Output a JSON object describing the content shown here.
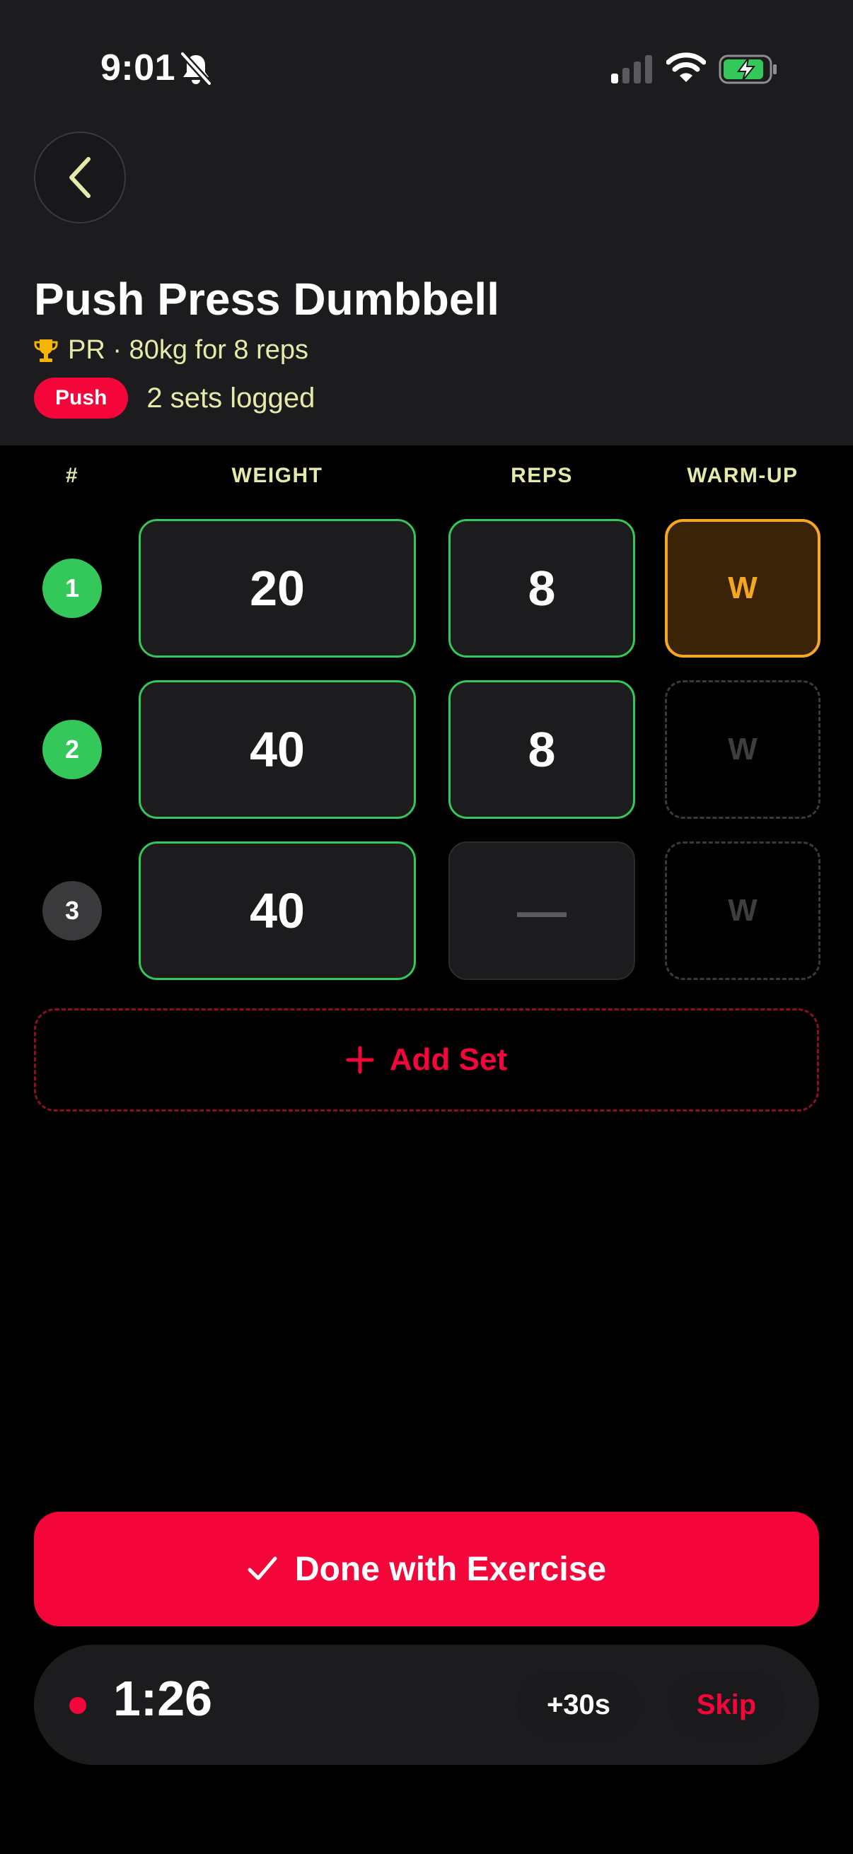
{
  "status_bar": {
    "time": "9:01"
  },
  "exercise": {
    "title": "Push Press Dumbbell",
    "pr_text": "PR · 80kg for 8 reps",
    "tag": "Push",
    "sets_logged": "2 sets logged"
  },
  "table": {
    "headers": {
      "num": "#",
      "weight": "WEIGHT",
      "reps": "REPS",
      "warmup": "WARM-UP"
    },
    "rows": [
      {
        "num": "1",
        "weight": "20",
        "reps": "8",
        "warmup": "W",
        "completed": true,
        "warmup_active": true
      },
      {
        "num": "2",
        "weight": "40",
        "reps": "8",
        "warmup": "W",
        "completed": true,
        "warmup_active": false
      },
      {
        "num": "3",
        "weight": "40",
        "reps": "—",
        "warmup": "W",
        "completed": false,
        "warmup_active": false
      }
    ]
  },
  "add_set_label": "Add Set",
  "done_label": "Done with Exercise",
  "rest_timer": {
    "time": "1:26",
    "add_label": "+30s",
    "skip_label": "Skip"
  },
  "colors": {
    "accent": "#f4063a",
    "complete": "#34c759",
    "warmup": "#f5a623",
    "subtitle": "#e6eaa8"
  }
}
